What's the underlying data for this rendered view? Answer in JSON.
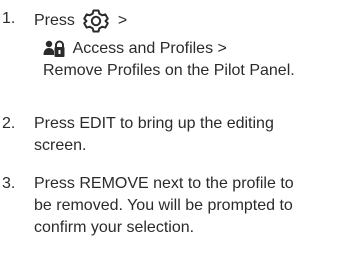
{
  "steps": [
    {
      "number": "1.",
      "lines": [
        {
          "prefix": "Press",
          "icon": "gear-icon",
          "suffix": ">"
        },
        {
          "icon": "access-profiles-icon",
          "text": "Access and Profiles >"
        },
        {
          "text": "Remove Profiles on the Pilot Panel."
        }
      ]
    },
    {
      "number": "2.",
      "lines": [
        {
          "text": "Press EDIT to bring up the editing"
        },
        {
          "text": "screen."
        }
      ]
    },
    {
      "number": "3.",
      "lines": [
        {
          "text": "Press REMOVE next to the profile to"
        },
        {
          "text": "be removed. You will be prompted to"
        },
        {
          "text": "confirm your selection."
        }
      ]
    }
  ]
}
